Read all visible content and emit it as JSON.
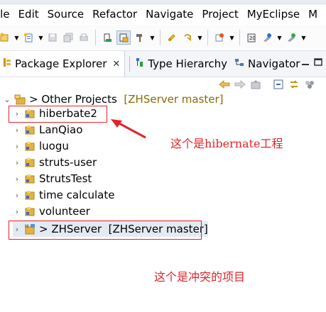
{
  "menu": [
    "File",
    "Edit",
    "Source",
    "Refactor",
    "Navigate",
    "Project",
    "MyEclipse",
    "M"
  ],
  "menu_first_visible": "ile",
  "toolbar_icons": [
    "new-wizard-icon",
    "new-icon",
    "save-icon",
    "save-all-icon",
    "print-icon",
    "open-console-icon",
    "build-icon",
    "hammer-icon",
    "prev-edit-icon",
    "next-edit-icon",
    "new-class-icon",
    "server-icon",
    "run-icon",
    "debug-icon"
  ],
  "tabs": {
    "package_explorer": "Package Explorer",
    "close": "✕",
    "type_hierarchy": "Type Hierarchy",
    "navigator": "Navigator"
  },
  "tree": {
    "root": {
      "prefix": ">",
      "label": "Other Projects",
      "repo": "[ZHServer master]"
    },
    "projects": [
      {
        "label": "hiberbate2"
      },
      {
        "label": "LanQiao"
      },
      {
        "label": "luogu"
      },
      {
        "label": "struts-user"
      },
      {
        "label": "StrutsTest"
      },
      {
        "label": "time calculate"
      },
      {
        "label": "volunteer"
      }
    ],
    "conflict": {
      "prefix": ">",
      "label": "ZHServer",
      "repo": "[ZHServer master]"
    }
  },
  "annotations": {
    "hibernate": "这个是hibernate工程",
    "conflict": "这个是冲突的项目"
  },
  "colors": {
    "annotation": "#e0242b",
    "repo_label": "#8a6a00",
    "folder": "#d8a838"
  }
}
